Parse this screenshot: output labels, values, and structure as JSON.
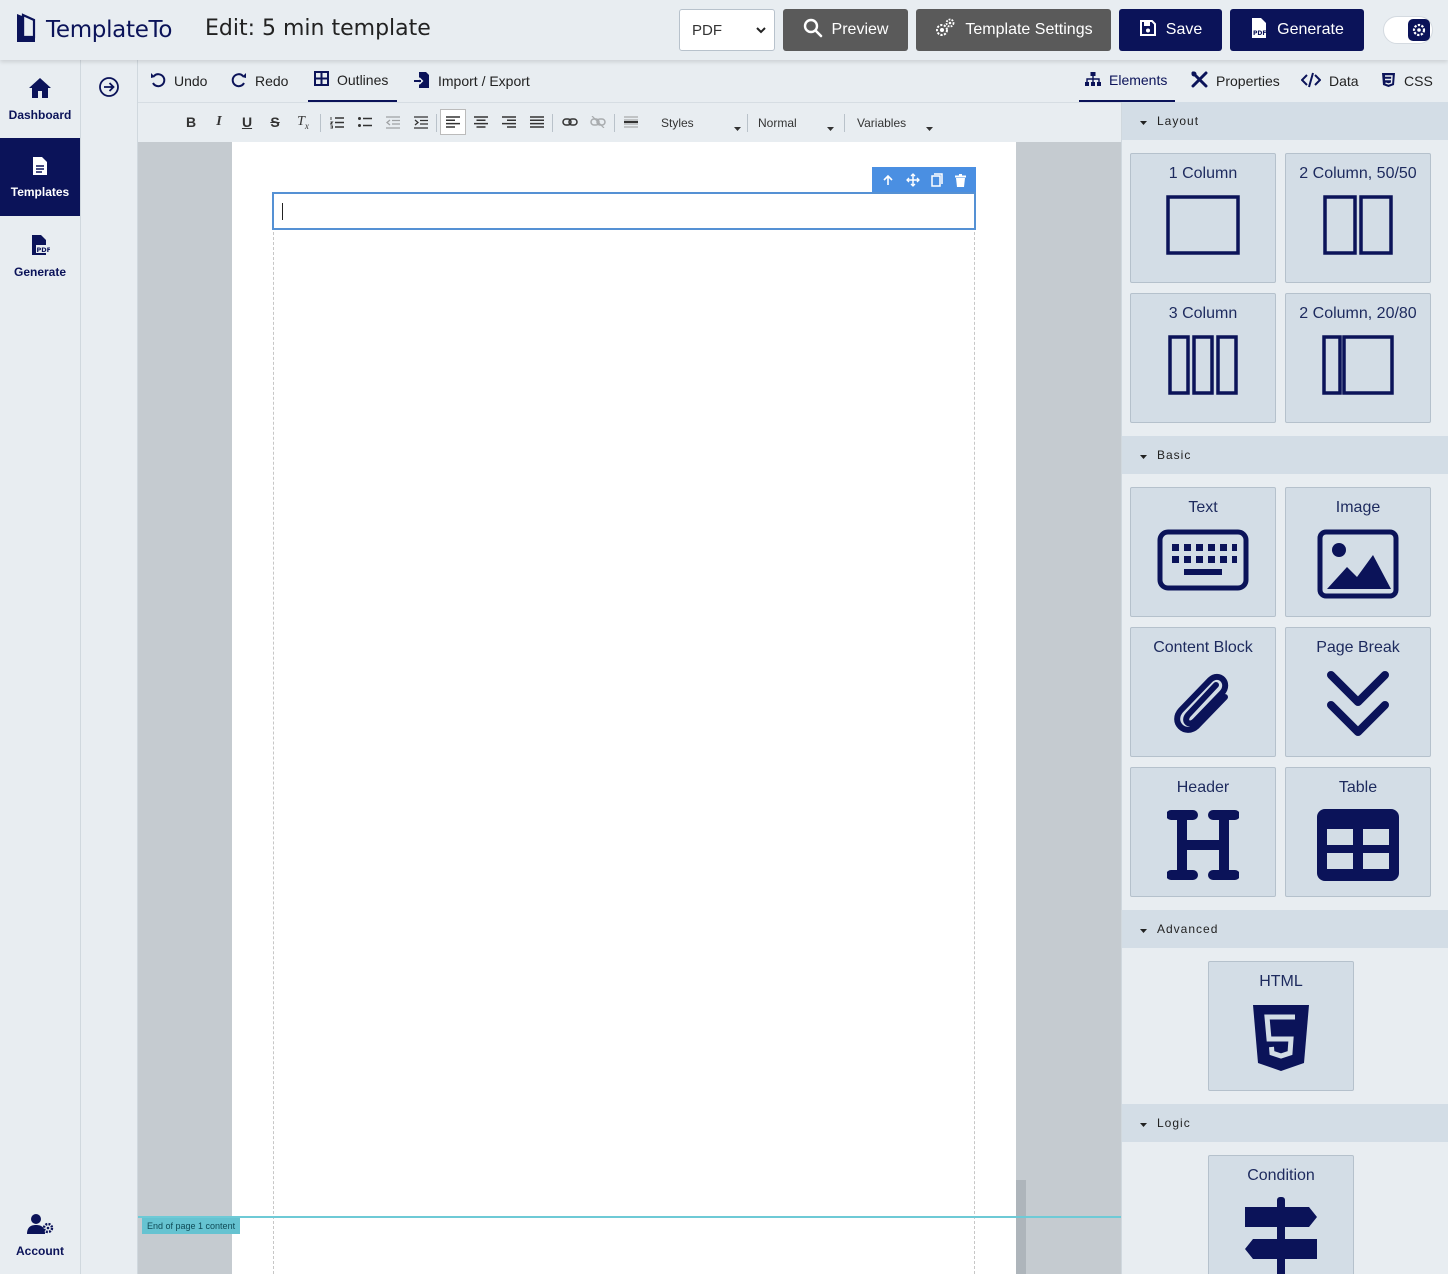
{
  "app": {
    "name": "TemplateTo",
    "page_title": "Edit: 5 min template"
  },
  "topbar": {
    "format_select": {
      "value": "PDF",
      "options": [
        "PDF"
      ]
    },
    "preview_label": "Preview",
    "template_settings_label": "Template Settings",
    "save_label": "Save",
    "generate_label": "Generate"
  },
  "sidebar": {
    "items": [
      {
        "label": "Dashboard",
        "icon": "home-icon",
        "active": false
      },
      {
        "label": "Templates",
        "icon": "file-icon",
        "active": true
      },
      {
        "label": "Generate",
        "icon": "pdf-icon",
        "active": false
      }
    ],
    "account_label": "Account"
  },
  "toolbar": {
    "undo": "Undo",
    "redo": "Redo",
    "outlines": "Outlines",
    "import_export": "Import / Export",
    "elements": "Elements",
    "properties": "Properties",
    "data": "Data",
    "css": "CSS"
  },
  "format_bar": {
    "styles": "Styles",
    "paragraph": "Normal",
    "variables": "Variables"
  },
  "canvas": {
    "page_end_label": "End of page 1 content"
  },
  "panel": {
    "sections": [
      {
        "title": "Layout",
        "items": [
          "1 Column",
          "2 Column, 50/50",
          "3 Column",
          "2 Column, 20/80"
        ]
      },
      {
        "title": "Basic",
        "items": [
          "Text",
          "Image",
          "Content Block",
          "Page Break",
          "Header",
          "Table"
        ]
      },
      {
        "title": "Advanced",
        "items": [
          "HTML"
        ]
      },
      {
        "title": "Logic",
        "items": [
          "Condition"
        ]
      }
    ]
  },
  "colors": {
    "brand": "#0b1359",
    "preview_button": "#5a5a5a",
    "selection": "#4a8fe2",
    "page_end": "#66c3d1"
  }
}
